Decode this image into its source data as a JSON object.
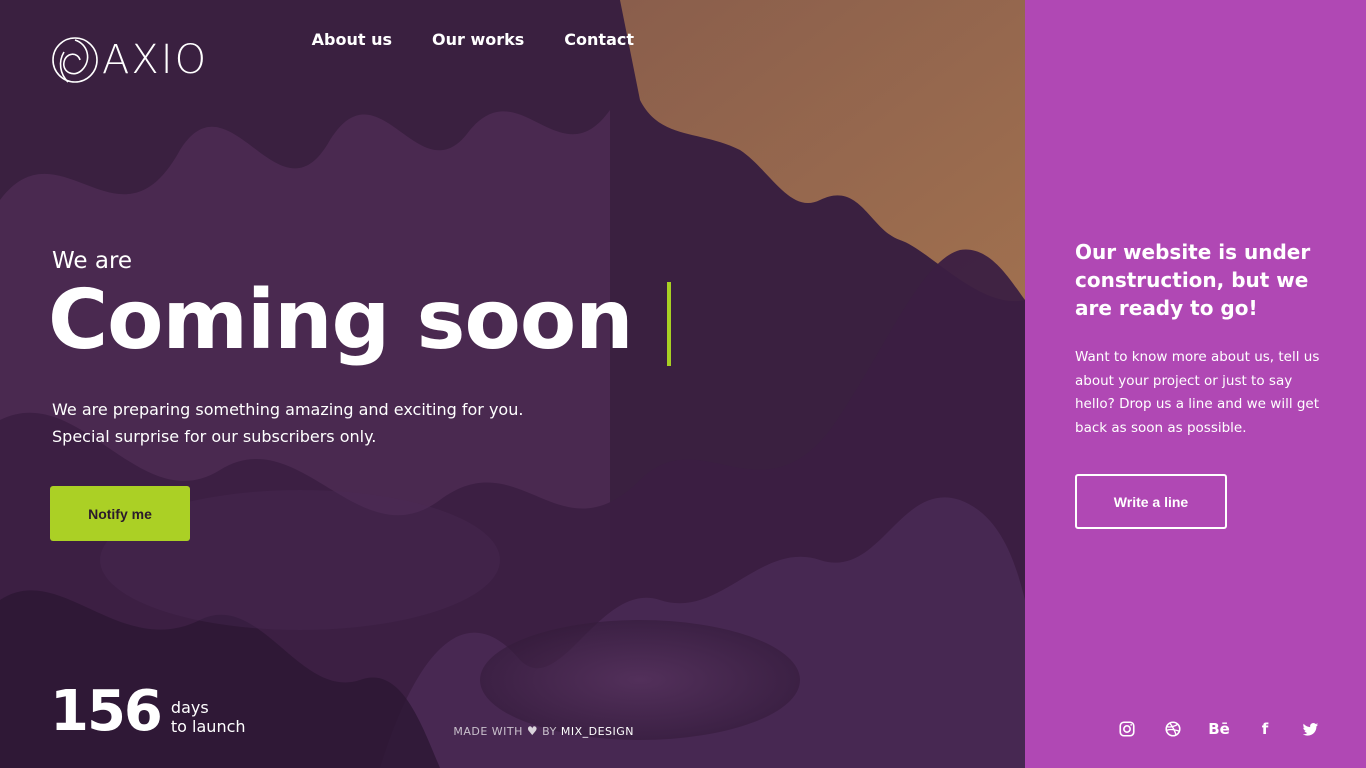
{
  "brand": {
    "name": "AXIO",
    "icon": "swirl-logo-icon"
  },
  "nav": {
    "items": [
      {
        "label": "About us"
      },
      {
        "label": "Our works"
      },
      {
        "label": "Contact"
      }
    ]
  },
  "hero": {
    "intro": "We are",
    "headline": "Coming soon",
    "line1": "We are preparing something amazing and exciting for you.",
    "line2": "Special surprise for our subscribers only.",
    "cta": "Notify me"
  },
  "countdown": {
    "value": "156",
    "line1": "days",
    "line2": "to launch"
  },
  "footer": {
    "made_with": "MADE WITH",
    "by": "BY",
    "brand": "MIX_DESIGN"
  },
  "side": {
    "title": "Our website is under construction, but we are ready to go!",
    "text": "Want to know more about us, tell us about your project or just to say hello? Drop us a line and we will get back as soon as possible.",
    "cta": "Write a line",
    "socials": [
      {
        "icon": "instagram-icon"
      },
      {
        "icon": "dribbble-icon"
      },
      {
        "icon": "behance-icon",
        "label": "Bē"
      },
      {
        "icon": "facebook-icon",
        "label": "f"
      },
      {
        "icon": "twitter-icon"
      }
    ]
  },
  "colors": {
    "accent": "#abd025",
    "side_panel": "#b048b4",
    "hero_dark": "#3a1f3c",
    "hero_tan": "#8e624f"
  }
}
